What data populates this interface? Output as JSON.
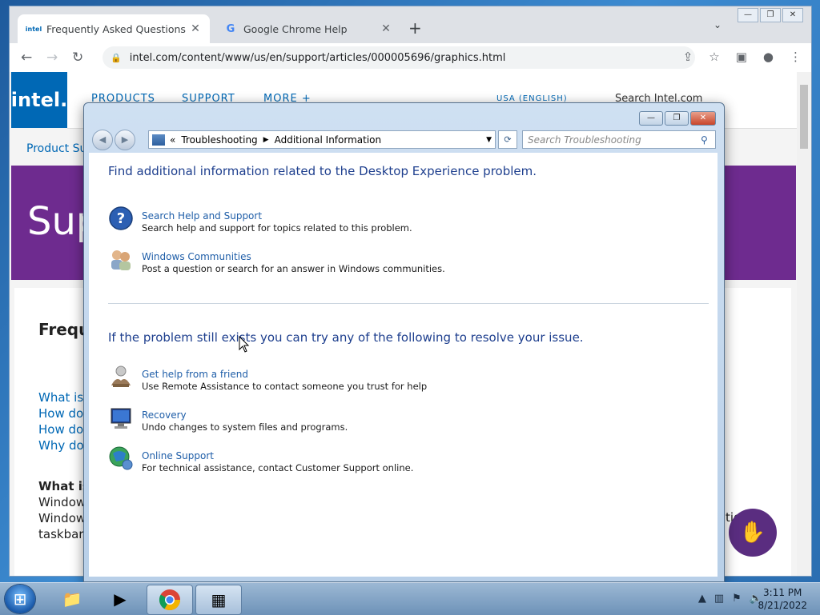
{
  "browser": {
    "tabs": [
      {
        "label": "Frequently Asked Questions for W",
        "active": true,
        "favicon": "intel"
      },
      {
        "label": "Google Chrome Help",
        "active": false,
        "favicon": "G"
      }
    ],
    "url": "intel.com/content/www/us/en/support/articles/000005696/graphics.html"
  },
  "intel_page": {
    "logo": "intel.",
    "nav": [
      "PRODUCTS",
      "SUPPORT",
      "MORE +"
    ],
    "region": "USA (ENGLISH)",
    "search_placeholder": "Search Intel.com",
    "breadcrumb": "Product Su",
    "banner_title": "Sup",
    "faq_heading": "Frequ",
    "faq_links": [
      "What is",
      "How do",
      "How do",
      "Why do"
    ],
    "section_title": "What is",
    "body_lines": [
      "Window",
      "Window",
      "taskbar"
    ],
    "trailing_text": "tion &"
  },
  "dialog": {
    "breadcrumb": [
      "Troubleshooting",
      "Additional Information"
    ],
    "search_placeholder": "Search Troubleshooting",
    "heading1": "Find additional information related to the Desktop Experience problem.",
    "tasks1": [
      {
        "icon": "help-icon",
        "title": "Search Help and Support",
        "desc": "Search help and support for topics related to this problem."
      },
      {
        "icon": "communities-icon",
        "title": "Windows Communities",
        "desc": "Post a question or search for an answer in Windows communities."
      }
    ],
    "heading2": "If the problem still exists you can try any of the following to resolve your issue.",
    "tasks2": [
      {
        "icon": "remote-assistance-icon",
        "title": "Get help from a friend",
        "desc": "Use Remote Assistance to contact someone you trust for help"
      },
      {
        "icon": "recovery-icon",
        "title": "Recovery",
        "desc": "Undo changes to system files and programs."
      },
      {
        "icon": "online-support-icon",
        "title": "Online Support",
        "desc": "For technical assistance, contact Customer Support online."
      }
    ]
  },
  "taskbar": {
    "time": "3:11 PM",
    "date": "8/21/2022"
  }
}
